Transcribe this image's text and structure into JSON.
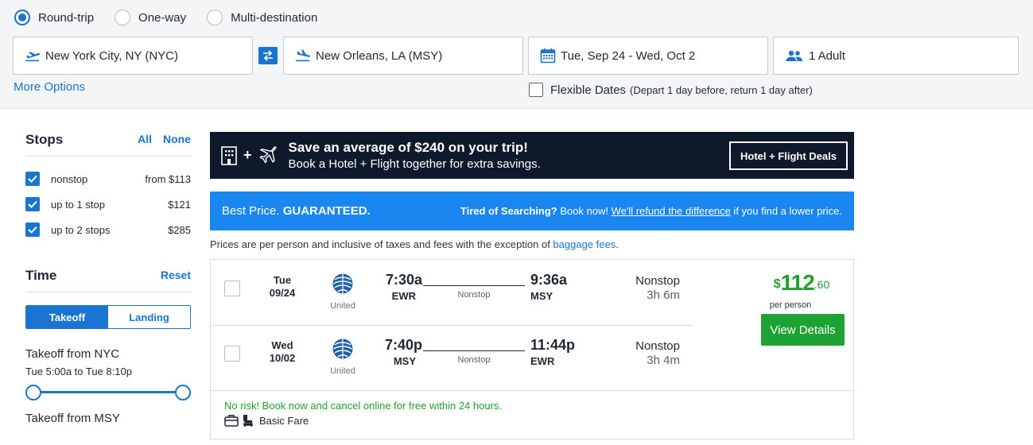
{
  "search": {
    "trip_types": [
      "Round-trip",
      "One-way",
      "Multi-destination"
    ],
    "selected_trip_type": "Round-trip",
    "origin": "New York City, NY (NYC)",
    "destination": "New Orleans, LA (MSY)",
    "dates": "Tue, Sep 24 - Wed, Oct 2",
    "travelers": "1 Adult",
    "more_options": "More Options",
    "flexible_label": "Flexible Dates",
    "flexible_note": "(Depart 1 day before, return 1 day after)"
  },
  "filters": {
    "stops_title": "Stops",
    "all": "All",
    "none": "None",
    "stops": [
      {
        "label": "nonstop",
        "price": "from $113",
        "checked": true
      },
      {
        "label": "up to 1 stop",
        "price": "$121",
        "checked": true
      },
      {
        "label": "up to 2 stops",
        "price": "$285",
        "checked": true
      }
    ],
    "time_title": "Time",
    "reset": "Reset",
    "takeoff_tab": "Takeoff",
    "landing_tab": "Landing",
    "takeoff_nyc_title": "Takeoff from NYC",
    "takeoff_nyc_range": "Tue 5:00a to Tue 8:10p",
    "takeoff_msy_title": "Takeoff from MSY"
  },
  "promo": {
    "headline": "Save an average of $240 on your trip!",
    "subline": "Book a Hotel + Flight together for extra savings.",
    "button": "Hotel + Flight Deals"
  },
  "guarantee": {
    "left_plain": "Best Price. ",
    "left_bold": "GUARANTEED.",
    "right_bold": "Tired of Searching?",
    "right_mid": " Book now! ",
    "right_link": "We'll refund the difference",
    "right_end": " if you find a lower price."
  },
  "disclaimer": {
    "text": "Prices are per person and inclusive of taxes and fees with the exception of ",
    "link": "baggage fees",
    "end": "."
  },
  "result": {
    "legs": [
      {
        "day": "Tue",
        "date": "09/24",
        "airline": "United",
        "dep_time": "7:30a",
        "dep_code": "EWR",
        "arr_time": "9:36a",
        "arr_code": "MSY",
        "line_label": "Nonstop",
        "stops": "Nonstop",
        "duration": "3h 6m"
      },
      {
        "day": "Wed",
        "date": "10/02",
        "airline": "United",
        "dep_time": "7:40p",
        "dep_code": "MSY",
        "arr_time": "11:44p",
        "arr_code": "EWR",
        "line_label": "Nonstop",
        "stops": "Nonstop",
        "duration": "3h 4m"
      }
    ],
    "currency": "$",
    "price_whole": "112",
    "price_cents": ".60",
    "per_person": "per person",
    "view_details": "View Details",
    "no_risk": "No risk! Book now and cancel online for free within 24 hours.",
    "fare": "Basic Fare"
  },
  "colors": {
    "accent": "#1a75d2",
    "promo_bg": "#0e1a2b",
    "guarantee_bg": "#1a86f0",
    "price_green": "#22a02d",
    "button_green": "#1ea233"
  }
}
